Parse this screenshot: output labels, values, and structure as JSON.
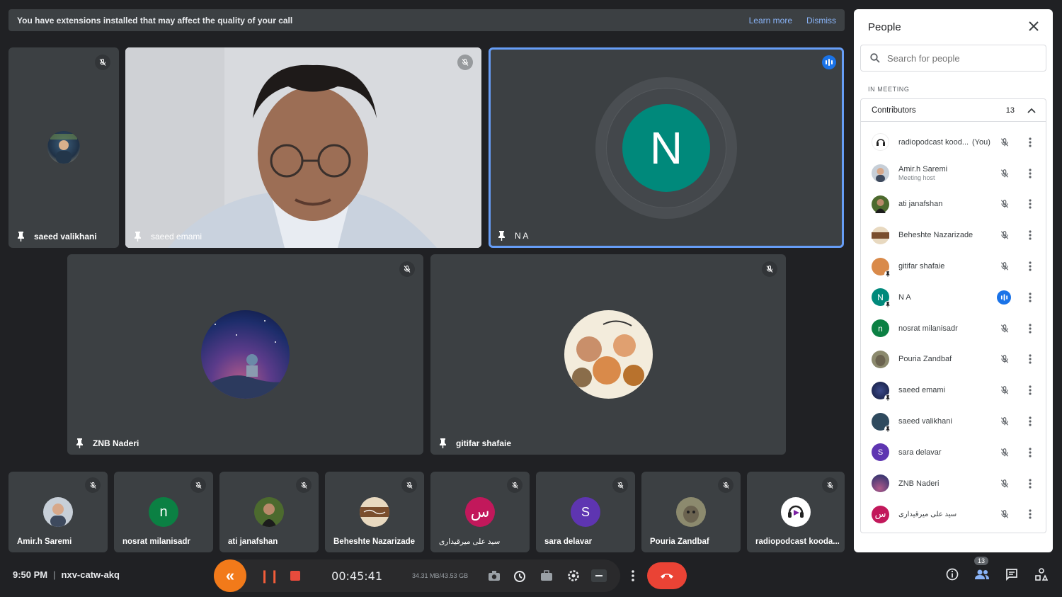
{
  "banner": {
    "message": "You have extensions installed that may affect the quality of your call",
    "learn_more": "Learn more",
    "dismiss": "Dismiss"
  },
  "tiles": {
    "saeed_valikhani": "saeed valikhani",
    "saeed_emami": "saeed emami",
    "na": "N A",
    "na_initial": "N",
    "znb": "ZNB Naderi",
    "gitifar": "gitifar shafaie"
  },
  "strip": [
    {
      "name": "Amir.h Saremi"
    },
    {
      "name": "nosrat milanisadr",
      "initial": "n"
    },
    {
      "name": "ati janafshan"
    },
    {
      "name": "Beheshte Nazarizade"
    },
    {
      "name": "سید علی میرقیداری",
      "initial": "س"
    },
    {
      "name": "sara delavar",
      "initial": "S"
    },
    {
      "name": "Pouria Zandbaf"
    },
    {
      "name": "radiopodcast kooda..."
    }
  ],
  "bottom_bar": {
    "time": "9:50 PM",
    "separator": "|",
    "meeting_code": "nxv-catw-akq",
    "people_count": "13"
  },
  "recorder": {
    "timer": "00:45:41",
    "size": "34.31 MB/43.53 GB"
  },
  "panel": {
    "title": "People",
    "search_placeholder": "Search for people",
    "in_meeting": "IN MEETING",
    "group_label": "Contributors",
    "group_count": "13",
    "participants": [
      {
        "name": "radiopodcast kood...",
        "you": "(You)"
      },
      {
        "name": "Amir.h Saremi",
        "sub": "Meeting host"
      },
      {
        "name": "ati janafshan"
      },
      {
        "name": "Beheshte Nazarizade"
      },
      {
        "name": "gitifar shafaie"
      },
      {
        "name": "N A",
        "initial": "N"
      },
      {
        "name": "nosrat milanisadr",
        "initial": "n"
      },
      {
        "name": "Pouria Zandbaf"
      },
      {
        "name": "saeed emami"
      },
      {
        "name": "saeed valikhani"
      },
      {
        "name": "sara delavar",
        "initial": "S"
      },
      {
        "name": "ZNB Naderi"
      },
      {
        "name": "سید علی میرقیداری",
        "initial": "س"
      }
    ]
  },
  "colors": {
    "background": "#202124",
    "tile": "#3c4043",
    "accent_blue": "#669df6",
    "avatar_teal": "#00897b",
    "avatar_green": "#0b8043",
    "avatar_pink": "#c2185b",
    "avatar_purple": "#5e35b1",
    "hangup_red": "#ea4335",
    "recorder_orange": "#f27a1a"
  }
}
